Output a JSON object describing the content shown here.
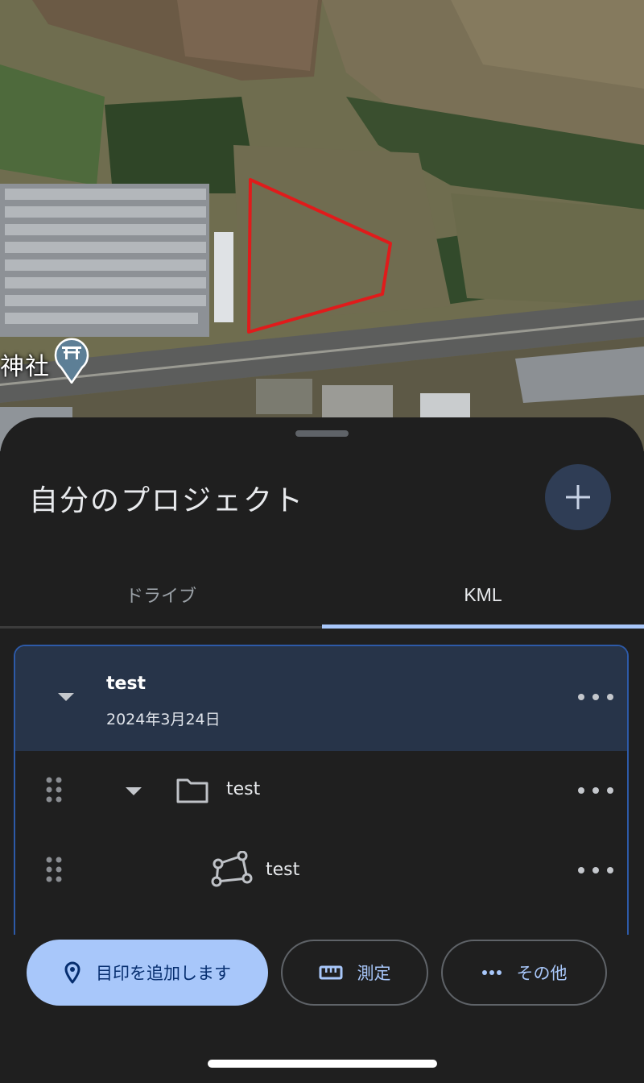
{
  "map": {
    "place_label": "神社",
    "icons": {
      "shrine": "torii-gate-pin-icon"
    },
    "colors": {
      "polygon_stroke": "#e01b1b"
    }
  },
  "sheet": {
    "title": "自分のプロジェクト",
    "add_button_icon": "plus-icon"
  },
  "tabs": [
    {
      "label": "ドライブ",
      "selected": false
    },
    {
      "label": "KML",
      "selected": true
    }
  ],
  "project": {
    "name": "test",
    "date": "2024年3月24日",
    "expanded": true,
    "children": [
      {
        "type": "folder",
        "label": "test",
        "icon": "folder-icon",
        "expanded": true
      },
      {
        "type": "polygon",
        "label": "test",
        "icon": "polygon-icon"
      }
    ]
  },
  "actions": {
    "add_marker": {
      "label": "目印を追加します",
      "icon": "location-pin-icon"
    },
    "measure": {
      "label": "測定",
      "icon": "ruler-icon"
    },
    "other": {
      "label": "その他",
      "icon": "more-horizontal-icon"
    }
  },
  "colors": {
    "accent": "#a8c7fa",
    "sheet_bg": "#1f1f1f",
    "selected_row_bg": "#273449",
    "fab_bg": "#2f3d55"
  }
}
